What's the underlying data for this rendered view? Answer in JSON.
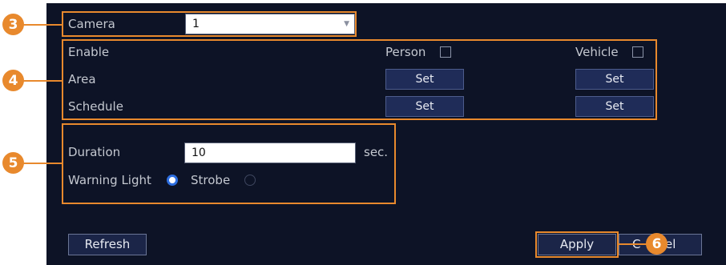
{
  "camera": {
    "label": "Camera",
    "value": "1"
  },
  "detection": {
    "enable_label": "Enable",
    "person_label": "Person",
    "person_checked": false,
    "vehicle_label": "Vehicle",
    "vehicle_checked": false,
    "area_label": "Area",
    "schedule_label": "Schedule",
    "set_label": "Set"
  },
  "alarm": {
    "duration_label": "Duration",
    "duration_value": "10",
    "duration_unit": "sec.",
    "warning_light_label": "Warning Light",
    "warning_light_selected": true,
    "strobe_label": "Strobe",
    "strobe_selected": false
  },
  "buttons": {
    "refresh": "Refresh",
    "apply": "Apply",
    "cancel_left": "C",
    "cancel_right": "el"
  },
  "callouts": [
    "3",
    "4",
    "5",
    "6"
  ],
  "colors": {
    "callout": "#e8892d",
    "panel": "#0d1326",
    "radio_selected": "#2d6ee0",
    "button": "#1f2c58"
  }
}
